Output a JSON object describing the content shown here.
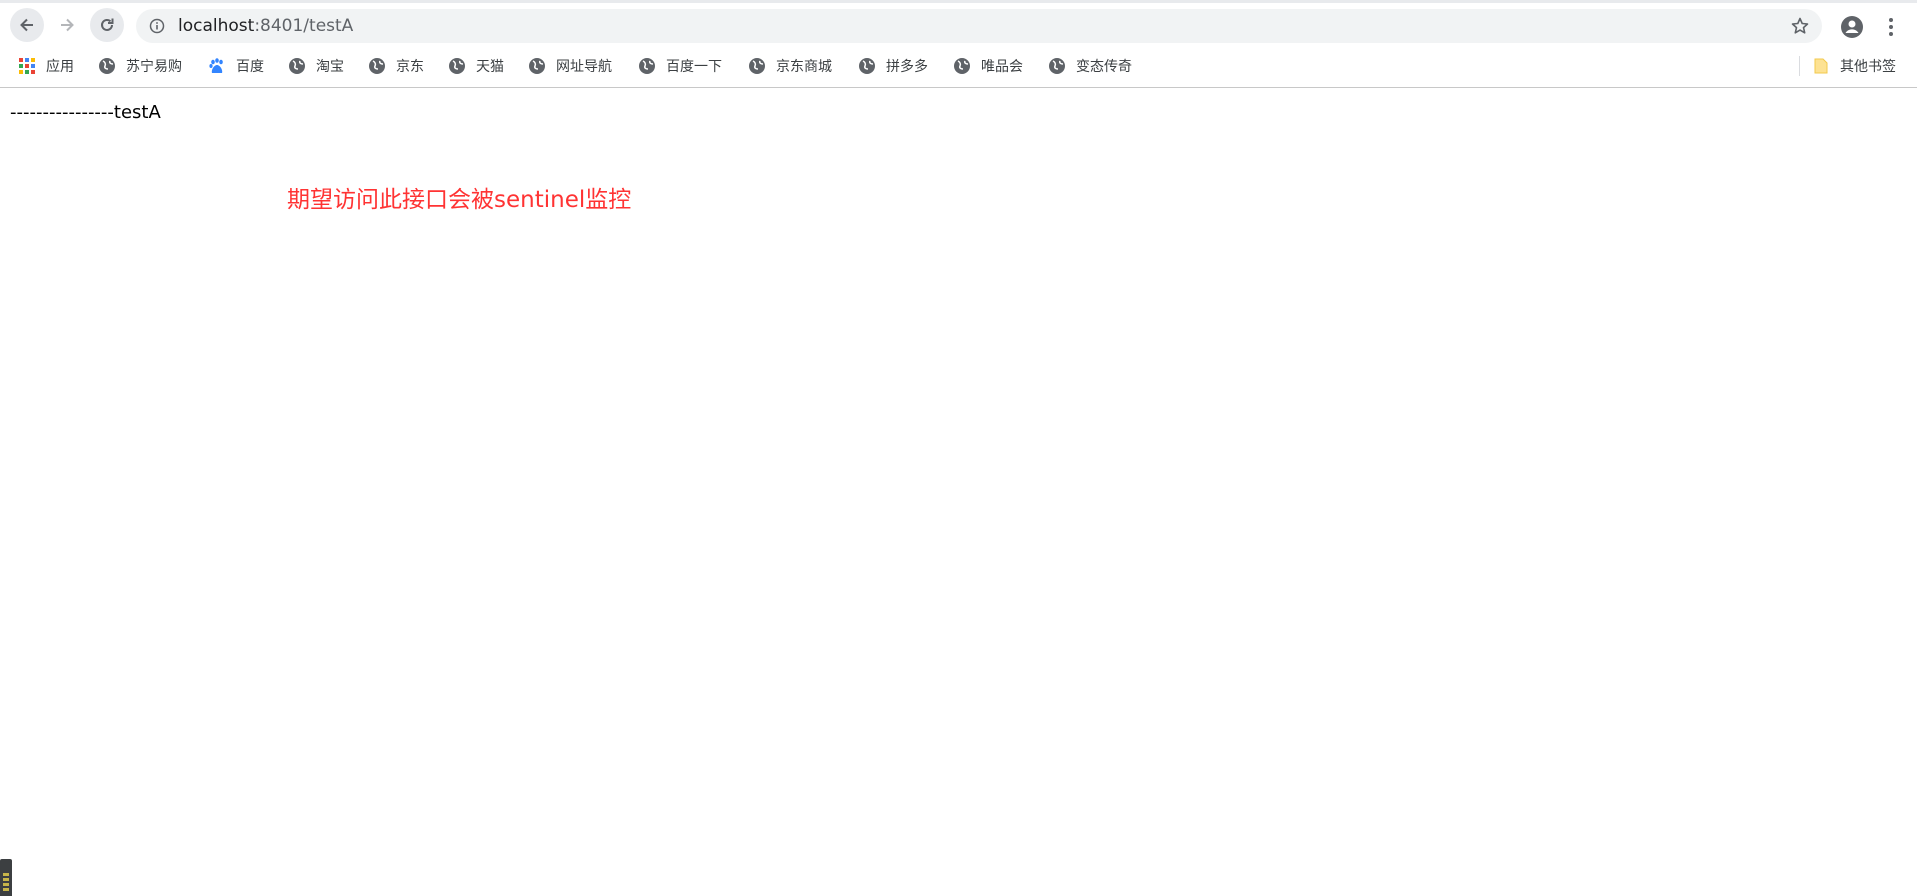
{
  "browser": {
    "url_host": "localhost",
    "url_path": ":8401/testA"
  },
  "bookmarks": [
    {
      "label": "应用",
      "icon": "apps-grid-icon"
    },
    {
      "label": "苏宁易购",
      "icon": "globe-icon"
    },
    {
      "label": "百度",
      "icon": "baidu-paw-icon"
    },
    {
      "label": "淘宝",
      "icon": "globe-icon"
    },
    {
      "label": "京东",
      "icon": "globe-icon"
    },
    {
      "label": "天猫",
      "icon": "globe-icon"
    },
    {
      "label": "网址导航",
      "icon": "globe-icon"
    },
    {
      "label": "百度一下",
      "icon": "globe-icon"
    },
    {
      "label": "京东商城",
      "icon": "globe-icon"
    },
    {
      "label": "拼多多",
      "icon": "globe-icon"
    },
    {
      "label": "唯品会",
      "icon": "globe-icon"
    },
    {
      "label": "变态传奇",
      "icon": "globe-icon"
    }
  ],
  "other_bookmarks": {
    "label": "其他书签",
    "icon": "folder-icon"
  },
  "page": {
    "line1": "----------------testA",
    "line2": "期望访问此接口会被sentinel监控"
  },
  "colors": {
    "annotation_red": "#ff3333",
    "omnibox_bg": "#f1f3f4"
  }
}
